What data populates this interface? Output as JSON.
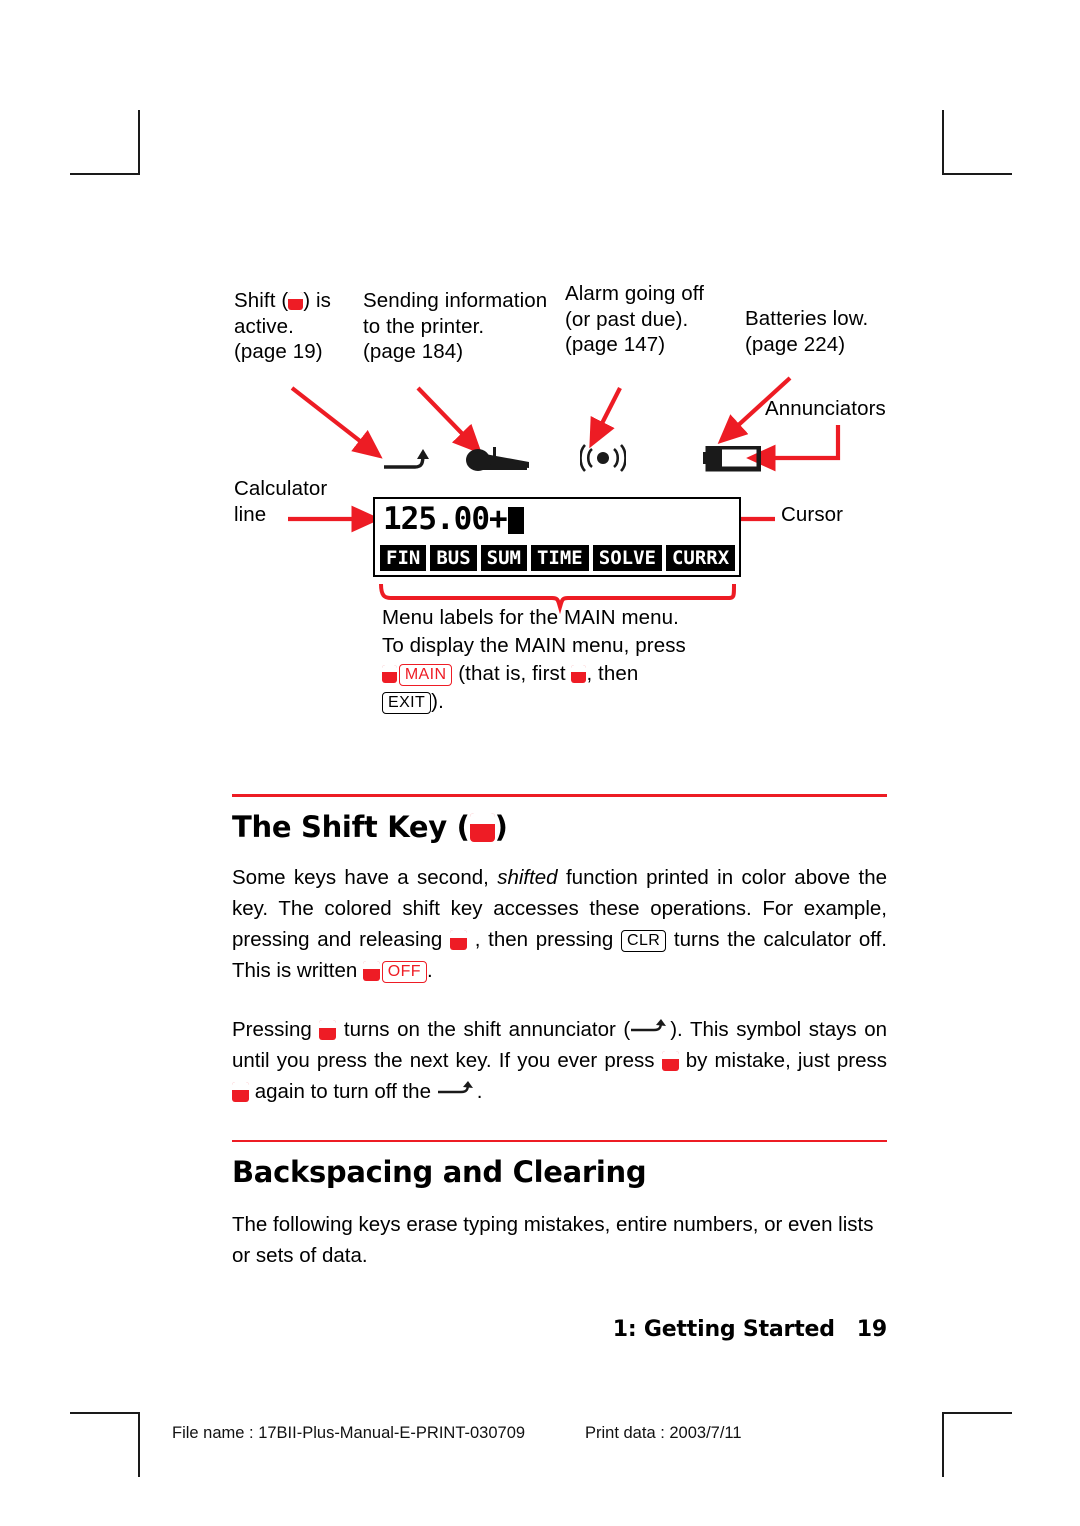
{
  "colors": {
    "accent_red": "#ed1c24",
    "key_red": "#ee1c25",
    "text_black": "#000000"
  },
  "diagram": {
    "callouts": [
      {
        "name": "shift-active",
        "lines": [
          "Shift (",
          ") is",
          "active.",
          "(page 19)"
        ],
        "line1_pre": "Shift (",
        "line1_post": ") is",
        "line2": "active.",
        "line3": "(page 19)"
      },
      {
        "name": "printer",
        "line1": "Sending information",
        "line2": "to the printer.",
        "line3": "(page 184)"
      },
      {
        "name": "alarm",
        "line1": "Alarm going off",
        "line2": "(or past due).",
        "line3": "(page 147)"
      },
      {
        "name": "batteries",
        "line1": "Batteries low.",
        "line2": "(page 224)"
      }
    ],
    "annunciators_label": "Annunciators",
    "calculator_line_label_1": "Calculator",
    "calculator_line_label_2": "line",
    "cursor_label": "Cursor",
    "menu_note": {
      "line1": "Menu labels for the MAIN menu.",
      "line2": "To display the MAIN menu, press",
      "line3_key": "MAIN",
      "line3_mid": "(that is, first",
      "line3_end": ", then",
      "line4_key": "EXIT",
      "line4_end": ")."
    }
  },
  "lcd": {
    "value": "125.00+",
    "menu_labels": [
      "FIN",
      "BUS",
      "SUM",
      "TIME",
      "SOLVE",
      "CURRX"
    ]
  },
  "sections": [
    {
      "heading_pre": "The Shift Key (",
      "heading_post": ")",
      "paragraphs": [
        {
          "p1": "Some keys have a second,",
          "italic": "shifted",
          "p2": "function printed in color above the key. The colored shift key accesses these operations. For example, pressing and releasing",
          "p3": ", then pressing",
          "key1": "CLR",
          "p4": "turns the calculator off. This is written",
          "key2": "OFF",
          "p5": "."
        },
        {
          "p1": "Pressing",
          "p2": "turns on the shift annunciator (",
          "p3": "). This symbol stays on until you press the next key. If you ever press",
          "p4": "by mistake, just press",
          "p5": "again to turn off the",
          "p6": "."
        }
      ]
    },
    {
      "heading": "Backspacing and Clearing",
      "body": "The following keys erase typing mistakes, entire numbers, or even lists or sets of data."
    }
  ],
  "footer": {
    "chapter": "1: Getting Started",
    "page_number": "19",
    "file_name_label": "File name : 17BII-Plus-Manual-E-PRINT-030709",
    "print_data_label": "Print data : 2003/7/11"
  }
}
